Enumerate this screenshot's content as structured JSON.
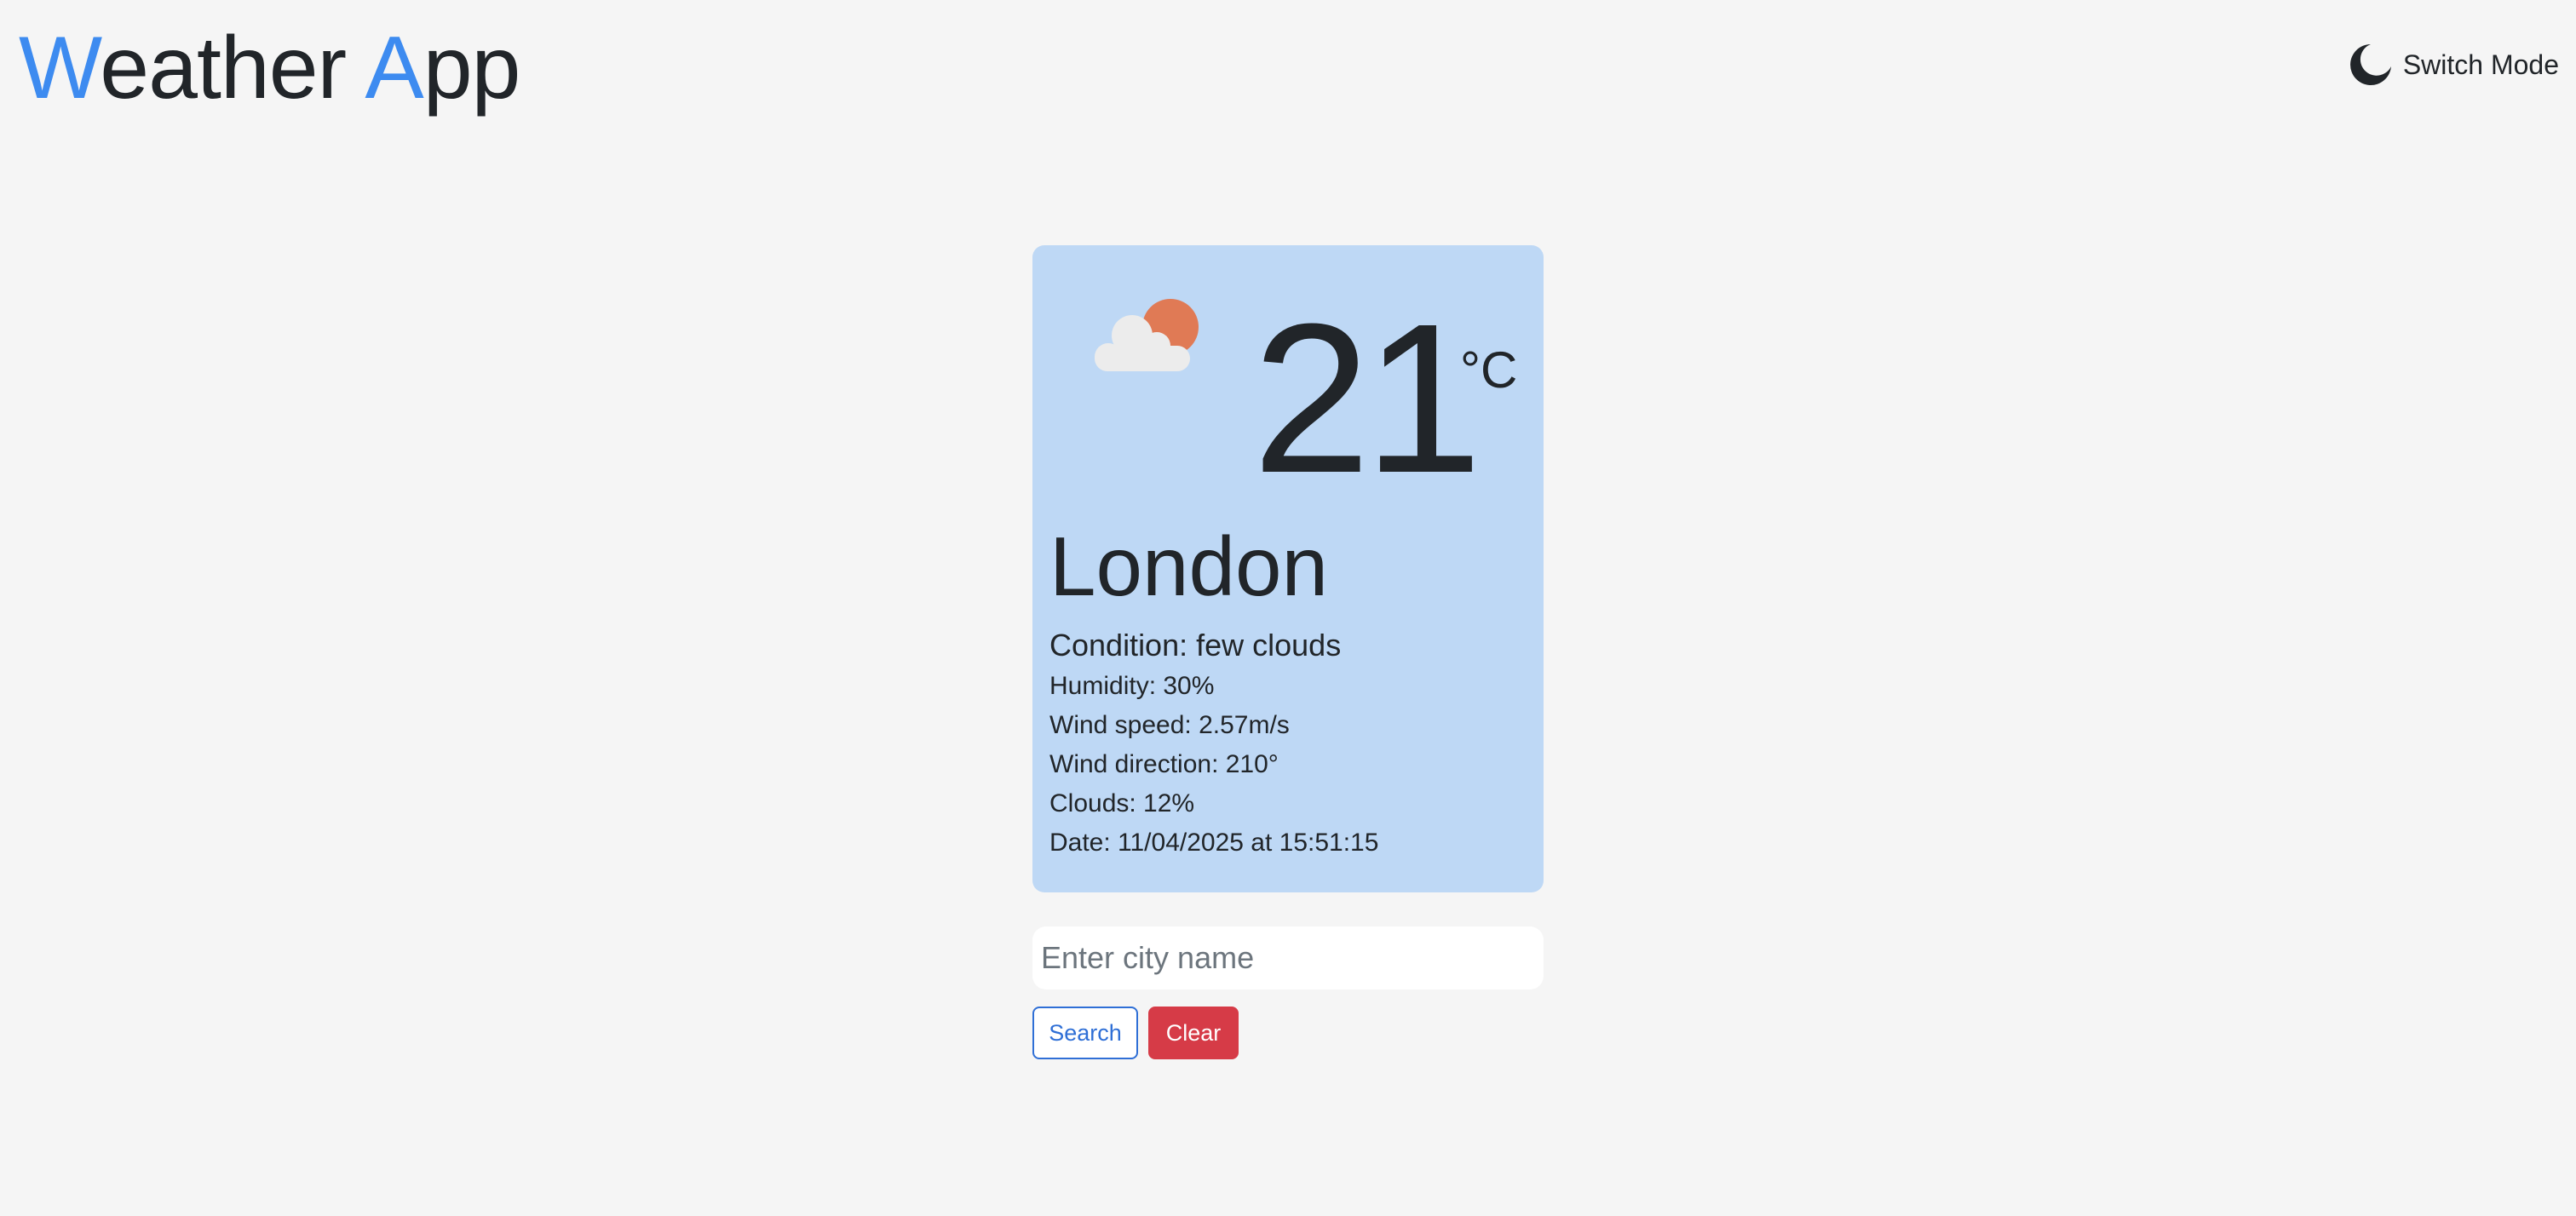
{
  "app": {
    "title_first_letter": "W",
    "title_rest_1": "eather ",
    "title_second_letter": "A",
    "title_rest_2": "pp",
    "accent_color": "#3d8bf0"
  },
  "mode_toggle": {
    "icon": "moon-icon",
    "label": "Switch Mode"
  },
  "weather": {
    "icon": "partly-cloudy-icon",
    "temperature": "21",
    "unit": "°C",
    "city": "London",
    "condition": "Condition: few clouds",
    "details": [
      "Humidity: 30%",
      "Wind speed: 2.57m/s",
      "Wind direction: 210°",
      "Clouds: 12%",
      "Date: 11/04/2025 at 15:51:15"
    ],
    "card_color": "#bed8f5"
  },
  "search": {
    "value": "",
    "placeholder": "Enter city name",
    "search_label": "Search",
    "clear_label": "Clear",
    "search_color": "#2f6fd6",
    "clear_color": "#d63b47"
  }
}
